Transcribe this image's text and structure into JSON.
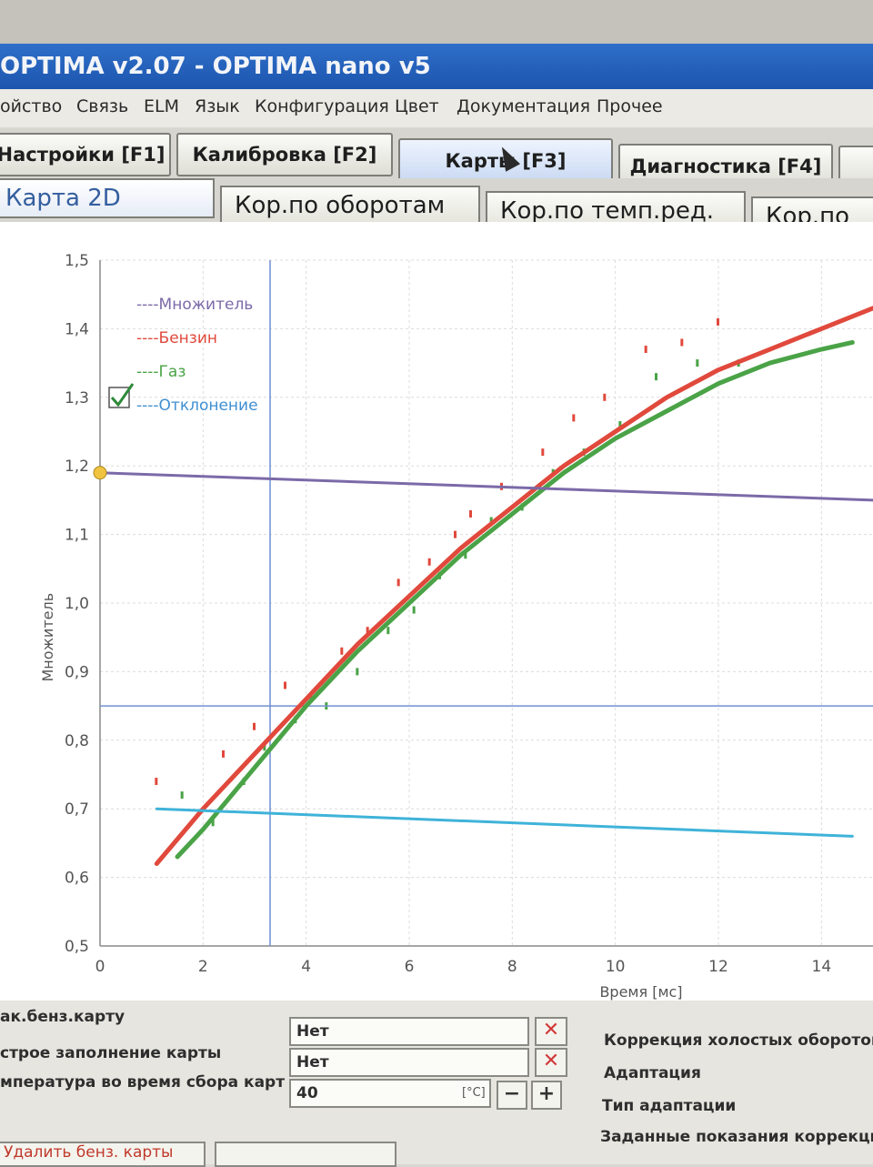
{
  "window": {
    "title": "OPTIMA v2.07 - OPTIMA nano v5"
  },
  "menu": [
    "ойство",
    "Связь",
    "ELM",
    "Язык",
    "Конфигурация",
    "Цвет",
    "Документация",
    "Прочее"
  ],
  "main_tabs": [
    "Настройки [F1]",
    "Калибровка [F2]",
    "Карты [F3]",
    "Диагностика [F4]"
  ],
  "sub_tabs": [
    "Карта 2D",
    "Кор.по оборотам",
    "Кор.по темп.ред.",
    "Кор.по"
  ],
  "legend": {
    "items": [
      "----Множитель",
      "----Бензин",
      "----Газ",
      "----Отклонение"
    ],
    "colors": [
      "#7b6aa8",
      "#e0493c",
      "#4aa347",
      "#3f8fd2"
    ]
  },
  "chart_data": {
    "type": "scatter",
    "xlabel": "Время [мс]",
    "ylabel": "Множитель",
    "xlim": [
      0,
      15
    ],
    "ylim": [
      0.5,
      1.5
    ],
    "x_ticks": [
      "0",
      "2",
      "4",
      "6",
      "8",
      "10",
      "12",
      "14"
    ],
    "y_ticks": [
      "0,5",
      "0,6",
      "0,7",
      "0,8",
      "0,9",
      "1,0",
      "1,1",
      "1,2",
      "1,3",
      "1,4",
      "1,5"
    ],
    "series": [
      {
        "name": "Бензин",
        "color": "#e0493c",
        "x": [
          1.1,
          2,
          3,
          4,
          5,
          6,
          7,
          8,
          9,
          10,
          11,
          12,
          13,
          14,
          15
        ],
        "y": [
          0.62,
          0.7,
          0.78,
          0.86,
          0.94,
          1.01,
          1.08,
          1.14,
          1.2,
          1.25,
          1.3,
          1.34,
          1.37,
          1.4,
          1.43
        ]
      },
      {
        "name": "Газ",
        "color": "#4aa347",
        "x": [
          1.5,
          2,
          3,
          4,
          5,
          6,
          7,
          8,
          9,
          10,
          11,
          12,
          13,
          14,
          14.6
        ],
        "y": [
          0.63,
          0.67,
          0.76,
          0.85,
          0.93,
          1.0,
          1.07,
          1.13,
          1.19,
          1.24,
          1.28,
          1.32,
          1.35,
          1.37,
          1.38
        ]
      },
      {
        "name": "Множитель",
        "color": "#7b6aa8",
        "x": [
          0,
          15
        ],
        "y": [
          1.19,
          1.15
        ]
      },
      {
        "name": "Отклонение",
        "color": "#3fb3d9",
        "x": [
          1.1,
          14.6
        ],
        "y": [
          0.7,
          0.66
        ]
      }
    ],
    "crosshair": {
      "x": 3.3,
      "y": 0.85
    },
    "marker": {
      "x": 0,
      "y": 1.19,
      "color": "#f0c341"
    },
    "scatter_points": {
      "red": [
        [
          1.1,
          0.74
        ],
        [
          2.4,
          0.78
        ],
        [
          3,
          0.82
        ],
        [
          3.6,
          0.88
        ],
        [
          4.1,
          0.86
        ],
        [
          4.7,
          0.93
        ],
        [
          5.2,
          0.96
        ],
        [
          5.8,
          1.03
        ],
        [
          6.4,
          1.06
        ],
        [
          6.9,
          1.1
        ],
        [
          7.2,
          1.13
        ],
        [
          7.8,
          1.17
        ],
        [
          8.6,
          1.22
        ],
        [
          9.2,
          1.27
        ],
        [
          9.8,
          1.3
        ],
        [
          10.6,
          1.37
        ],
        [
          11.3,
          1.38
        ],
        [
          12,
          1.41
        ]
      ],
      "green": [
        [
          1.6,
          0.72
        ],
        [
          2.2,
          0.68
        ],
        [
          2.8,
          0.74
        ],
        [
          3.2,
          0.79
        ],
        [
          3.8,
          0.83
        ],
        [
          4.4,
          0.85
        ],
        [
          5,
          0.9
        ],
        [
          5.6,
          0.96
        ],
        [
          6.1,
          0.99
        ],
        [
          6.6,
          1.04
        ],
        [
          7.1,
          1.07
        ],
        [
          7.6,
          1.12
        ],
        [
          8.2,
          1.14
        ],
        [
          8.8,
          1.19
        ],
        [
          9.4,
          1.22
        ],
        [
          10.1,
          1.26
        ],
        [
          10.8,
          1.33
        ],
        [
          11.6,
          1.35
        ],
        [
          12.4,
          1.35
        ]
      ]
    }
  },
  "controls": {
    "row1_label": "ак.бенз.карту",
    "row1_value": "Нет",
    "row2_label": "строе заполнение карты",
    "row2_value": "Нет",
    "row3_label": "мпература во время сбора карт",
    "row3_value": "40",
    "row3_unit": "[°C]",
    "minus": "−",
    "plus": "+",
    "clear": "✕",
    "right_labels": [
      "Коррекция холостых оборотов",
      "Адаптация",
      "Тип адаптации",
      "Заданные показания коррекции"
    ],
    "bottom_tab": "Удалить бенз. карты"
  }
}
